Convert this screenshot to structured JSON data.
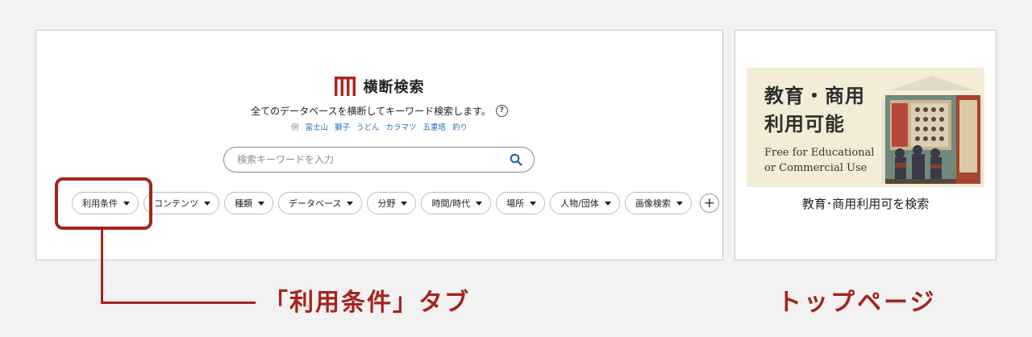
{
  "header": {
    "title": "横断検索",
    "tagline": "全てのデータベースを横断してキーワード検索します。",
    "help_icon": "?"
  },
  "examples": {
    "label": "例",
    "items": [
      "富士山",
      "獅子",
      "うどん",
      "カラマツ",
      "五重塔",
      "釣り"
    ]
  },
  "search": {
    "placeholder": "検索キーワードを入力",
    "value": ""
  },
  "filters": [
    {
      "label": "利用条件"
    },
    {
      "label": "コンテンツ"
    },
    {
      "label": "種類"
    },
    {
      "label": "データベース"
    },
    {
      "label": "分野"
    },
    {
      "label": "時間/時代"
    },
    {
      "label": "場所"
    },
    {
      "label": "人物/団体"
    },
    {
      "label": "画像検索"
    }
  ],
  "add_filter": "+",
  "annotations": {
    "tab_callout": "「利用条件」タブ",
    "top_page": "トップページ"
  },
  "side": {
    "banner_title_line1": "教育・商用",
    "banner_title_line2": "利用可能",
    "banner_sub_line1": "Free for Educational",
    "banner_sub_line2": "or Commercial Use",
    "caption": "教育･商用利用可を検索"
  },
  "colors": {
    "accent": "#a6241c",
    "link": "#2a6fb4",
    "banner_bg": "#f3ecd6"
  },
  "icons": {
    "logo": "museum-logo-icon",
    "search": "search-icon",
    "help": "help-icon",
    "caret": "caret-down-icon",
    "add": "plus-icon"
  }
}
